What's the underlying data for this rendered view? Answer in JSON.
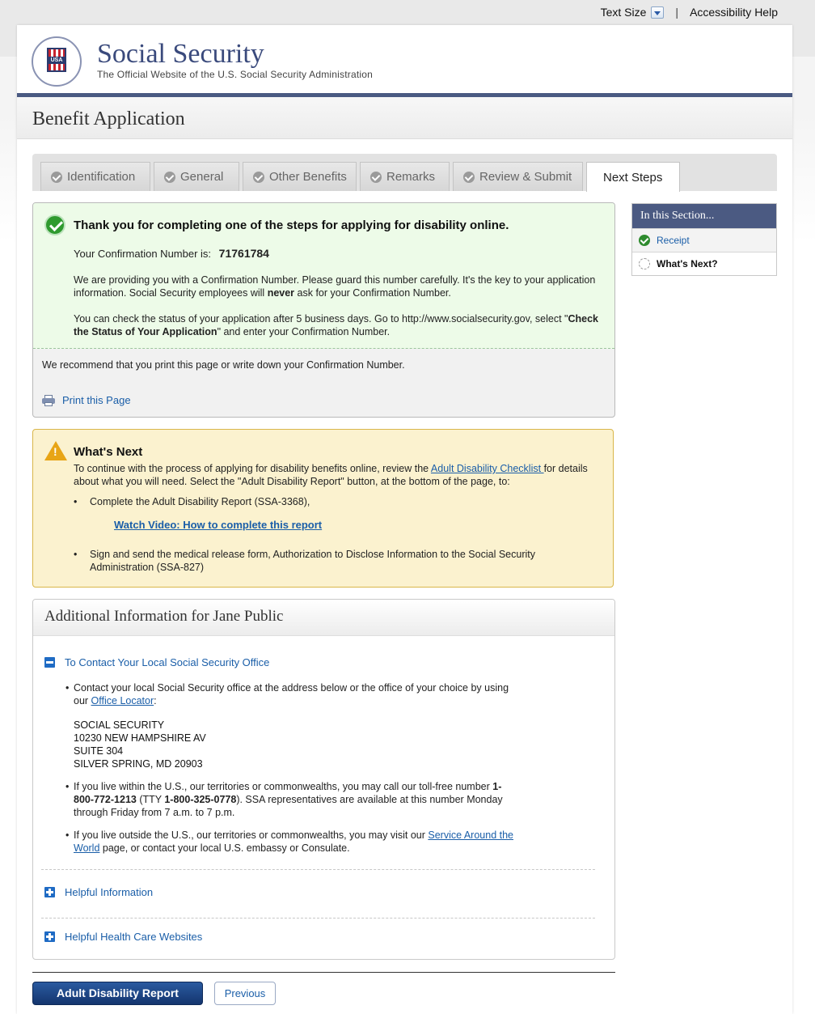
{
  "utility": {
    "text_size": "Text Size",
    "separator": "|",
    "accessibility_help": "Accessibility Help"
  },
  "header": {
    "seal_text": "USA",
    "title": "Social Security",
    "subtitle": "The Official Website of the U.S. Social Security Administration"
  },
  "app": {
    "title": "Benefit Application"
  },
  "tabs": [
    {
      "label": "Identification",
      "state": "complete"
    },
    {
      "label": "General",
      "state": "complete"
    },
    {
      "label": "Other Benefits",
      "state": "complete"
    },
    {
      "label": "Remarks",
      "state": "complete"
    },
    {
      "label": "Review & Submit",
      "state": "complete"
    },
    {
      "label": "Next Steps",
      "state": "active"
    }
  ],
  "sidebar": {
    "heading": "In this Section...",
    "items": [
      {
        "label": "Receipt",
        "state": "done"
      },
      {
        "label": "What's Next?",
        "state": "current"
      }
    ]
  },
  "success": {
    "title": "Thank you for completing one of the steps for applying for disability online.",
    "confirmation_label": "Your Confirmation Number is:",
    "confirmation_number": "71761784",
    "para1_a": "We are providing you with a Confirmation Number. Please guard this number carefully. It's the key to your application information. Social Security employees will ",
    "para1_bold": "never",
    "para1_b": " ask for your Confirmation Number.",
    "para2_a": "You can check the status of your application after 5 business days. Go to http://www.socialsecurity.gov, select \"",
    "para2_bold": "Check the Status of Your Application",
    "para2_b": "\" and enter your Confirmation Number.",
    "recommend": "We recommend that you print this page or write down your Confirmation Number.",
    "print_link": "Print this Page"
  },
  "whats_next": {
    "title": "What's Next",
    "intro_a": "To continue with the process of applying for disability benefits online, review the ",
    "intro_link": "Adult Disability Checklist ",
    "intro_b": "for details about what you will need. Select the \"Adult Disability Report\" button, at the bottom of the page, to:",
    "bullet1": "Complete the Adult Disability Report (SSA-3368),",
    "video_link": "Watch Video: How to complete this report",
    "bullet2": "Sign and send the medical release form, Authorization to Disclose Information to the Social Security Administration (SSA-827)"
  },
  "additional": {
    "heading": "Additional Information for Jane Public",
    "section1_title": "To Contact Your Local Social Security Office",
    "b1_a": "Contact your local Social Security office at the address below or the office of your choice by using our ",
    "b1_link": "Office Locator",
    "b1_b": ":",
    "address": [
      "SOCIAL SECURITY",
      "10230 NEW HAMPSHIRE AV",
      "SUITE 304",
      "SILVER SPRING, MD 20903"
    ],
    "b2_a": "If you live within the U.S., our territories or commonwealths, you may call our toll-free number ",
    "b2_phone": "1-800-772-1213",
    "b2_b": " (TTY ",
    "b2_tty": "1-800-325-0778",
    "b2_c": "). SSA representatives are available at this number Monday through Friday from 7 a.m. to 7 p.m.",
    "b3_a": "If you live outside the U.S., our territories or commonwealths, you may visit our ",
    "b3_link": "Service Around the World",
    "b3_b": " page, or contact your local U.S. embassy or Consulate.",
    "section2_title": "Helpful Information",
    "section3_title": "Helpful Health Care Websites"
  },
  "buttons": {
    "primary": "Adult Disability Report",
    "secondary": "Previous"
  }
}
